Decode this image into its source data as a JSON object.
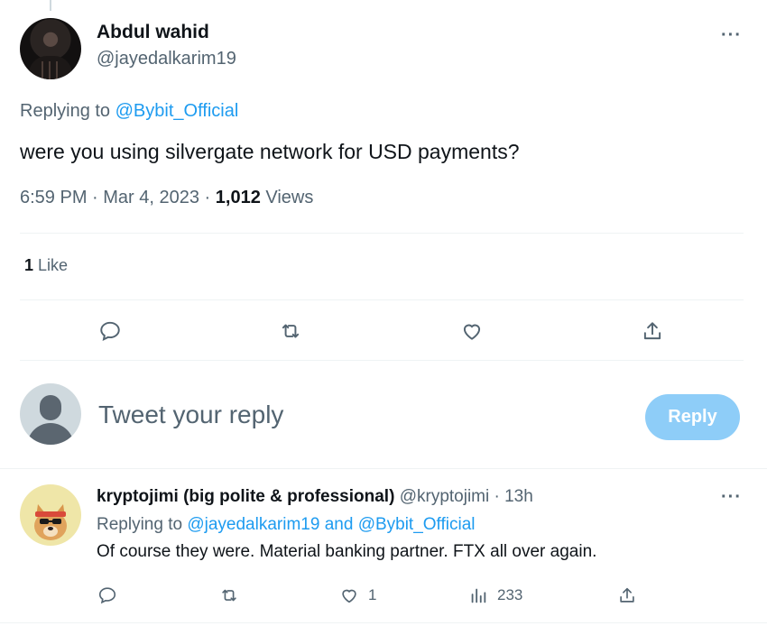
{
  "tweet": {
    "author_name": "Abdul wahid",
    "author_handle": "@jayedalkarim19",
    "more_label": "···",
    "replying_prefix": "Replying to ",
    "replying_to": "@Bybit_Official",
    "text": "were you using silvergate network for USD payments?",
    "timestamp": "6:59 PM · Mar 4, 2023 · ",
    "views_count": "1,012",
    "views_label": " Views",
    "likes_count": "1",
    "likes_label": " Like",
    "actions": [
      "reply-icon",
      "retweet-icon",
      "like-icon",
      "share-icon"
    ]
  },
  "composer": {
    "placeholder": "Tweet your reply",
    "button_label": "Reply",
    "button_color": "#8ecdf8"
  },
  "reply": {
    "author_name": "kryptojimi (big polite & professional)",
    "author_handle": "@kryptojimi",
    "time": " · 13h",
    "more_label": "···",
    "replying_prefix": "Replying to ",
    "replying_to_1": "@jayedalkarim19",
    "replying_and": " and ",
    "replying_to_2": "@Bybit_Official",
    "text": "Of course they were. Material banking partner. FTX all over again.",
    "like_count": "1",
    "views_count": "233"
  },
  "colors": {
    "link": "#1d9bf0",
    "secondary_text": "#536471",
    "primary_text": "#0f1419",
    "divider": "#eff3f4"
  }
}
